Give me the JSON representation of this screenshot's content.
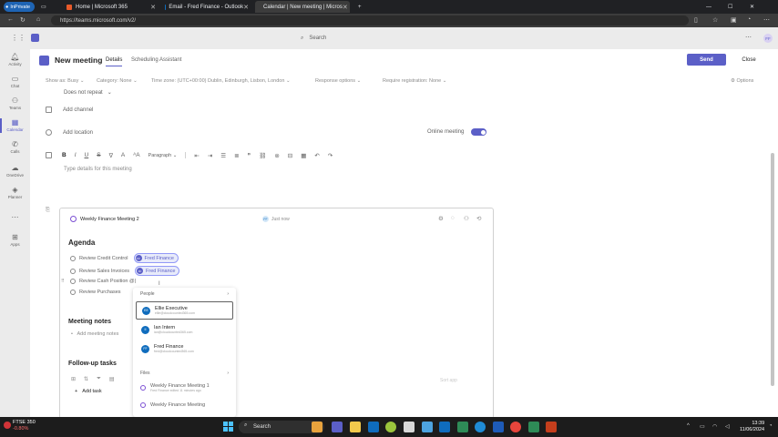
{
  "browser": {
    "inprivate_label": "InPrivate",
    "tabs": [
      {
        "title": "Home | Microsoft 365"
      },
      {
        "title": "Email - Fred Finance - Outlook"
      },
      {
        "title": "Calendar | New meeting | Micros"
      }
    ],
    "url": "https://teams.microsoft.com/v2/"
  },
  "teams": {
    "search_placeholder": "Search",
    "avatar_initials": "FF"
  },
  "rail": [
    {
      "label": "Activity",
      "icon": "bell-icon"
    },
    {
      "label": "Chat",
      "icon": "chat-icon"
    },
    {
      "label": "Teams",
      "icon": "teams-icon"
    },
    {
      "label": "Calendar",
      "icon": "calendar-icon"
    },
    {
      "label": "Calls",
      "icon": "phone-icon"
    },
    {
      "label": "OneDrive",
      "icon": "cloud-icon"
    },
    {
      "label": "Planner",
      "icon": "planner-icon"
    },
    {
      "label": "Apps",
      "icon": "apps-icon"
    }
  ],
  "meeting": {
    "title": "New meeting",
    "tab_details": "Details",
    "tab_scheduling": "Scheduling Assistant",
    "send_label": "Send",
    "close_label": "Close",
    "options": {
      "show_as": "Show as: Busy",
      "category": "Category: None",
      "time_zone": "Time zone: (UTC+00:00) Dublin, Edinburgh, Lisbon, London",
      "response": "Response options",
      "registration": "Require registration: None",
      "more": "Options"
    },
    "repeat": "Does not repeat",
    "add_channel": "Add channel",
    "add_location": "Add location",
    "online_meeting_label": "Online meeting",
    "online_meeting_on": true,
    "paragraph_label": "Paragraph",
    "details_placeholder": "Type details for this meeting"
  },
  "loop": {
    "title": "Weekly Finance Meeting 2",
    "edited": "Just now",
    "editor_initials": "FF",
    "agenda_heading": "Agenda",
    "agenda": [
      {
        "text": "Review Credit Control",
        "mention": "Fred Finance"
      },
      {
        "text": "Review Sales Invoices",
        "mention": "Fred Finance"
      },
      {
        "text": "Review Cash Position @|",
        "mention": null
      },
      {
        "text": "Review Purchases",
        "mention": null
      }
    ],
    "notes_heading": "Meeting notes",
    "notes_placeholder": "Add meeting notes",
    "followup_heading": "Follow-up tasks",
    "add_task": "Add task",
    "sort_label": "Sort app"
  },
  "mention_popup": {
    "people_label": "People",
    "files_label": "Files",
    "people": [
      {
        "name": "Ellie Executive",
        "email": "ellie@cloudcounted365.com",
        "initials": "EE"
      },
      {
        "name": "Ian Intern",
        "email": "ian@cloudcounted365.com",
        "initials": "II"
      },
      {
        "name": "Fred Finance",
        "email": "fred@cloudcounted365.com",
        "initials": "FF"
      }
    ],
    "files": [
      {
        "name": "Weekly Finance Meeting 1",
        "sub": "Fred Finance edited 11 minutes ago"
      },
      {
        "name": "Weekly Finance Meeting",
        "sub": ""
      }
    ]
  },
  "taskbar": {
    "ticker": "FTSE 350",
    "ticker_change": "-0.80%",
    "search_label": "Search",
    "time": "13:39",
    "date": "11/06/2024"
  },
  "colors": {
    "accent": "#5b5fc7",
    "chrome_dark": "#202124"
  }
}
